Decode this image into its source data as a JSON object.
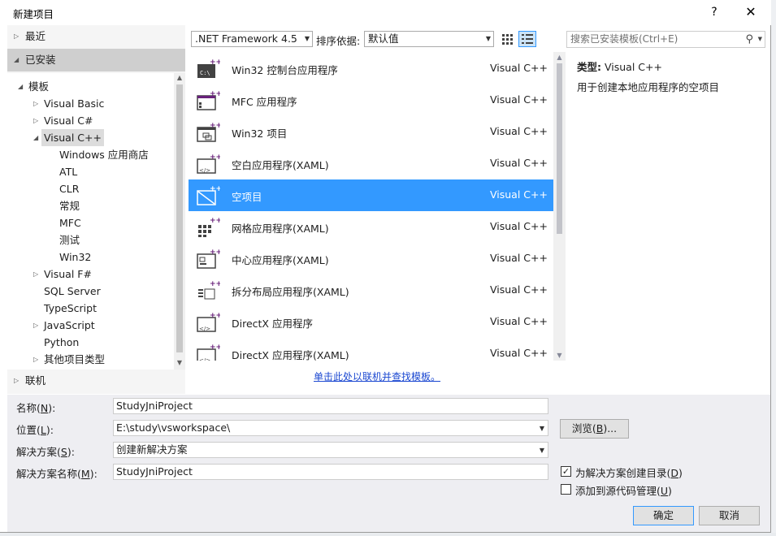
{
  "window": {
    "title": "新建项目",
    "help_label": "?",
    "close_label": "✕"
  },
  "left": {
    "recent_label": "最近",
    "installed_label": "已安装",
    "online_label": "联机",
    "tree": [
      {
        "label": "模板",
        "arrow": "◢"
      },
      {
        "label": "Visual Basic",
        "arrow": "▷"
      },
      {
        "label": "Visual C#",
        "arrow": "▷"
      },
      {
        "label": "Visual C++",
        "arrow": "◢"
      },
      {
        "label": "Windows 应用商店",
        "arrow": ""
      },
      {
        "label": "ATL",
        "arrow": ""
      },
      {
        "label": "CLR",
        "arrow": ""
      },
      {
        "label": "常规",
        "arrow": ""
      },
      {
        "label": "MFC",
        "arrow": ""
      },
      {
        "label": "测试",
        "arrow": ""
      },
      {
        "label": "Win32",
        "arrow": ""
      },
      {
        "label": "Visual F#",
        "arrow": "▷"
      },
      {
        "label": "SQL Server",
        "arrow": ""
      },
      {
        "label": "TypeScript",
        "arrow": ""
      },
      {
        "label": "JavaScript",
        "arrow": "▷"
      },
      {
        "label": "Python",
        "arrow": ""
      },
      {
        "label": "其他项目类型",
        "arrow": "▷"
      }
    ]
  },
  "toolbar": {
    "framework": ".NET Framework 4.5",
    "sort_label": "排序依据:",
    "sort_value": "默认值",
    "search_placeholder": "搜索已安装模板(Ctrl+E)"
  },
  "templates": [
    {
      "name": "Win32 控制台应用程序",
      "lang": "Visual C++",
      "icon": "console-app-icon"
    },
    {
      "name": "MFC 应用程序",
      "lang": "Visual C++",
      "icon": "mfc-app-icon"
    },
    {
      "name": "Win32 项目",
      "lang": "Visual C++",
      "icon": "win32-project-icon"
    },
    {
      "name": "空白应用程序(XAML)",
      "lang": "Visual C++",
      "icon": "blank-xaml-app-icon"
    },
    {
      "name": "空项目",
      "lang": "Visual C++",
      "icon": "empty-project-icon"
    },
    {
      "name": "网格应用程序(XAML)",
      "lang": "Visual C++",
      "icon": "grid-xaml-app-icon"
    },
    {
      "name": "中心应用程序(XAML)",
      "lang": "Visual C++",
      "icon": "hub-xaml-app-icon"
    },
    {
      "name": "拆分布局应用程序(XAML)",
      "lang": "Visual C++",
      "icon": "split-xaml-app-icon"
    },
    {
      "name": "DirectX 应用程序",
      "lang": "Visual C++",
      "icon": "directx-app-icon"
    },
    {
      "name": "DirectX 应用程序(XAML)",
      "lang": "Visual C++",
      "icon": "directx-xaml-app-icon"
    }
  ],
  "selected_template_index": 4,
  "online_link": "单击此处以联机并查找模板。",
  "info": {
    "type_label": "类型:",
    "type_value": "Visual C++",
    "description": "用于创建本地应用程序的空项目"
  },
  "form": {
    "name_label": "名称(",
    "name_key": "N",
    "name_value": "StudyJniProject",
    "location_label": "位置(",
    "location_key": "L",
    "location_value": "E:\\study\\vsworkspace\\",
    "solution_label": "解决方案(",
    "solution_key": "S",
    "solution_value": "创建新解决方案",
    "solution_name_label": "解决方案名称(",
    "solution_name_key": "M",
    "solution_name_value": "StudyJniProject",
    "browse_label": "浏览(",
    "browse_key": "B",
    "create_dir_label": "为解决方案创建目录(",
    "create_dir_key": "D",
    "create_dir_checked": true,
    "source_control_label": "添加到源代码管理(",
    "source_control_key": "U",
    "source_control_checked": false,
    "ok_label": "确定",
    "cancel_label": "取消"
  },
  "colors": {
    "accent": "#3399ff",
    "link": "#1a47d1",
    "vc_purple": "#68217a"
  }
}
